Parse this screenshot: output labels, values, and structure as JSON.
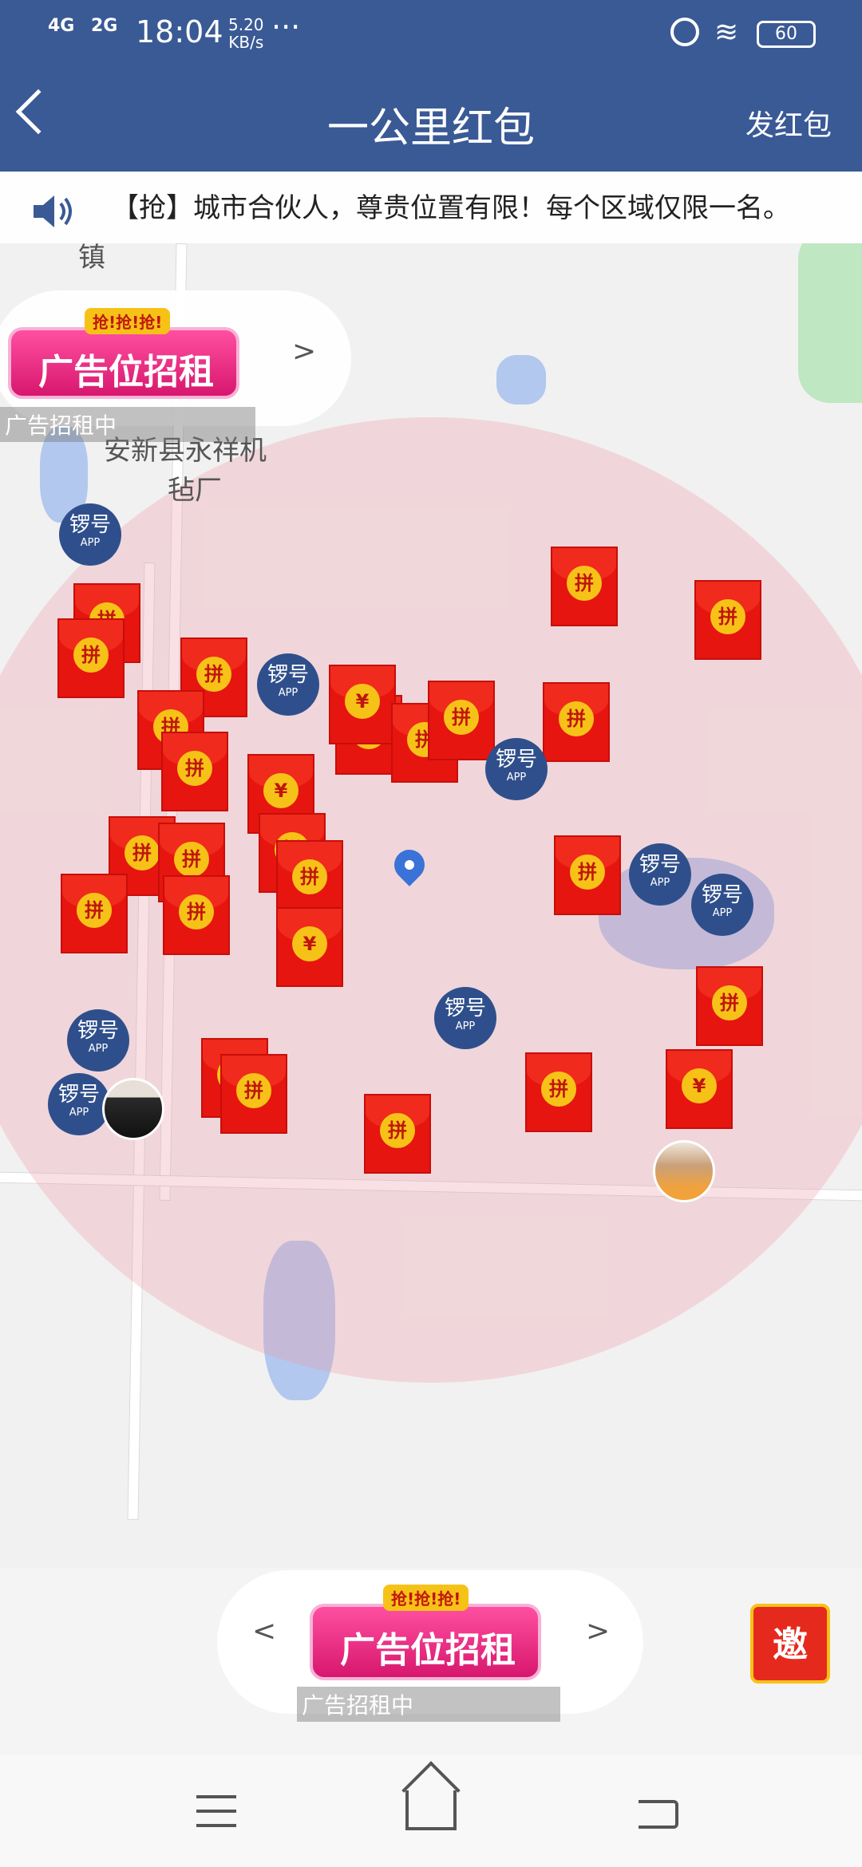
{
  "status_bar": {
    "signal_1": "4G",
    "signal_2": "2G",
    "time": "18:04",
    "speed_value": "5.20",
    "speed_unit": "KB/s",
    "dots": "···",
    "battery": "60"
  },
  "header": {
    "back_icon": "chevron-left-icon",
    "title": "一公里红包",
    "action_label": "发红包"
  },
  "notice": {
    "icon": "speaker-icon",
    "text": "【抢】城市合伙人，尊贵位置有限！每个区域仅限一名。"
  },
  "map": {
    "place_label_line1": "安新县永祥机",
    "place_label_line2": "毡厂",
    "town_label": "镇",
    "range_color": "#eca0aa"
  },
  "envelope_labels": {
    "pin": "拼",
    "yuan": "¥"
  },
  "app_badge": {
    "name": "锣号",
    "sub": "APP"
  },
  "top_ad": {
    "small_text": "抢!抢!抢!",
    "big_text": "广告位招租",
    "arrow": ">",
    "caption": "广告招租中"
  },
  "bottom_ad": {
    "small_text": "抢!抢!抢!",
    "big_text": "广告位招租",
    "left_arrow": "<",
    "right_arrow": ">",
    "caption": "广告招租中"
  },
  "invite_button": {
    "label": "邀",
    "icon": "envelope-invite-icon"
  },
  "nav_bar": {
    "menu_icon": "menu-icon",
    "home_icon": "home-icon",
    "back_icon": "back-icon"
  }
}
